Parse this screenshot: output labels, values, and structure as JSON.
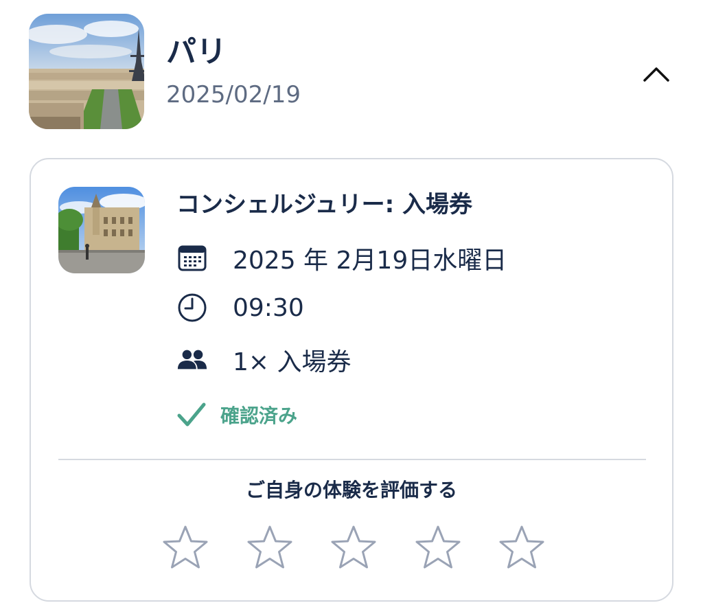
{
  "trip": {
    "title": "パリ",
    "date": "2025/02/19",
    "thumbnail_icon": "paris-eiffel-tower-photo",
    "collapse_icon": "chevron-up-icon"
  },
  "booking": {
    "thumbnail_icon": "conciergerie-photo",
    "title": "コンシェルジュリー: 入場券",
    "date_text": "2025 年 2月19日水曜日",
    "time_text": "09:30",
    "tickets_text": "1× 入場券",
    "status_text": "確認済み",
    "rate_prompt": "ご自身の体験を評価する",
    "rating": {
      "value": 0,
      "max": 5
    }
  },
  "colors": {
    "primary_text": "#1a2b49",
    "secondary_text": "#5e6b82",
    "confirmed_green": "#4ba38b",
    "border": "#d5d9e0",
    "star_outline": "#9aa3b5"
  }
}
